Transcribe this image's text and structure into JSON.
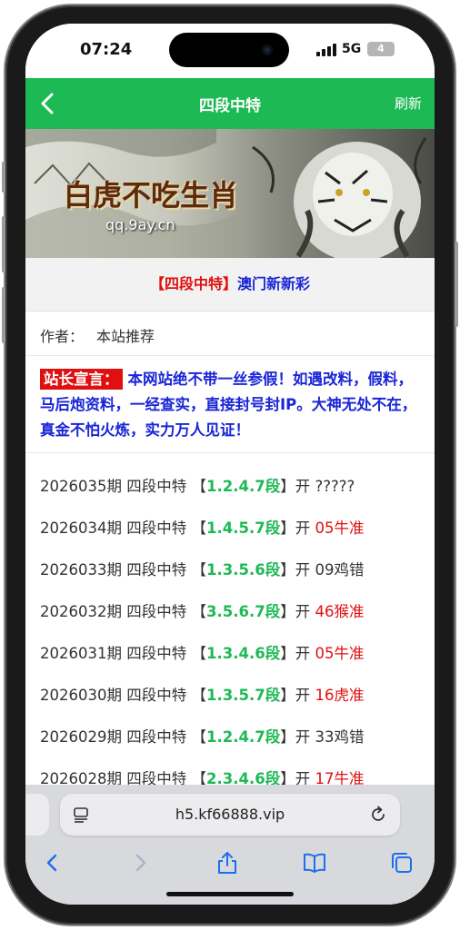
{
  "status_bar": {
    "time": "07:24",
    "network": "5G",
    "battery": "4"
  },
  "navbar": {
    "title": "四段中特",
    "refresh_label": "刷新"
  },
  "banner": {
    "title": "白虎不吃生肖",
    "domain": "qq.9ay.cn"
  },
  "heading": {
    "bracket": "【四段中特】",
    "name": "澳门新新彩"
  },
  "author": {
    "label": "作者：",
    "name": "本站推荐"
  },
  "notice": {
    "tag": "站长宣言：",
    "text": "本网站绝不带一丝参假！如遇改料，假料，马后炮资料，一经查实，直接封号封IP。大神无处不在，真金不怕火炼，实力万人见证！"
  },
  "records": [
    {
      "period": "2026035期",
      "label": "四段中特",
      "open": "【",
      "code": "1.2.4.7段",
      "close": "】",
      "kai": "开",
      "result": "?????",
      "highlight": false
    },
    {
      "period": "2026034期",
      "label": "四段中特",
      "open": "【",
      "code": "1.4.5.7段",
      "close": "】",
      "kai": "开",
      "result": "05牛准",
      "highlight": true
    },
    {
      "period": "2026033期",
      "label": "四段中特",
      "open": "【",
      "code": "1.3.5.6段",
      "close": "】",
      "kai": "开",
      "result": "09鸡错",
      "highlight": false
    },
    {
      "period": "2026032期",
      "label": "四段中特",
      "open": "【",
      "code": "3.5.6.7段",
      "close": "】",
      "kai": "开",
      "result": "46猴准",
      "highlight": true
    },
    {
      "period": "2026031期",
      "label": "四段中特",
      "open": "【",
      "code": "1.3.4.6段",
      "close": "】",
      "kai": "开",
      "result": "05牛准",
      "highlight": true
    },
    {
      "period": "2026030期",
      "label": "四段中特",
      "open": "【",
      "code": "1.3.5.7段",
      "close": "】",
      "kai": "开",
      "result": "16虎准",
      "highlight": true
    },
    {
      "period": "2026029期",
      "label": "四段中特",
      "open": "【",
      "code": "1.2.4.7段",
      "close": "】",
      "kai": "开",
      "result": "33鸡错",
      "highlight": false
    },
    {
      "period": "2026028期",
      "label": "四段中特",
      "open": "【",
      "code": "2.3.4.6段",
      "close": "】",
      "kai": "开",
      "result": "17牛准",
      "highlight": true
    }
  ],
  "browser": {
    "url": "h5.kf66888.vip"
  },
  "colors": {
    "nav_green": "#1db954",
    "red": "#e01010",
    "blue": "#1a26d6"
  },
  "icons": [
    "back-chevron-icon",
    "page-settings-icon",
    "reload-icon",
    "back-icon",
    "forward-icon",
    "share-icon",
    "bookmarks-icon",
    "tabs-icon"
  ]
}
